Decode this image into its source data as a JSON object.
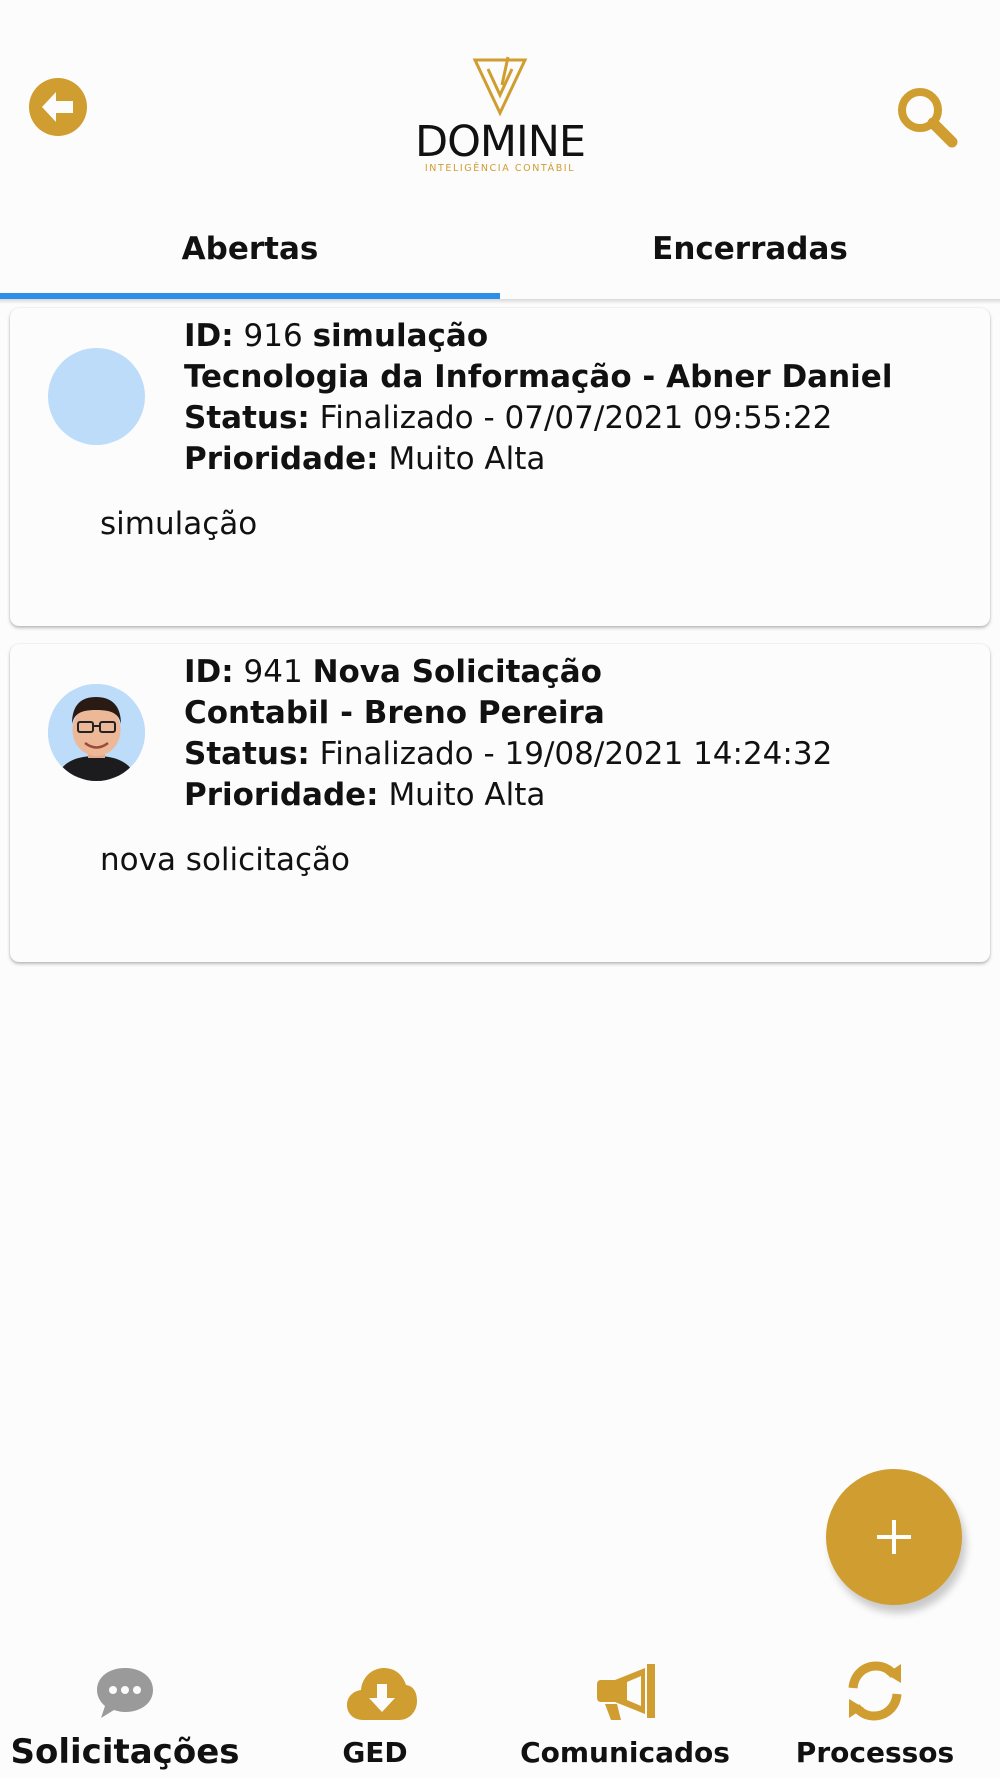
{
  "header": {
    "logo_word": "DOMINE",
    "logo_sub": "INTELIGÊNCIA CONTÁBIL",
    "back_icon": "arrow-left-circle-icon",
    "search_icon": "search-icon"
  },
  "colors": {
    "brand": "#cf9d30",
    "tab_indicator": "#2e8fe6",
    "avatar_bg": "#bcdcfa"
  },
  "tabs": [
    {
      "label": "Abertas",
      "active": true
    },
    {
      "label": "Encerradas",
      "active": false
    }
  ],
  "labels": {
    "id": "ID:",
    "status": "Status:",
    "priority": "Prioridade:"
  },
  "requests": [
    {
      "id": "916",
      "title": "simulação",
      "department_user": "Tecnologia da Informação - Abner Daniel",
      "status": "Finalizado - 07/07/2021 09:55:22",
      "priority": "Muito Alta",
      "description": "simulação",
      "avatar": "blank"
    },
    {
      "id": "941",
      "title": "Nova Solicitação",
      "department_user": "Contabil - Breno Pereira",
      "status": "Finalizado - 19/08/2021 14:24:32",
      "priority": "Muito Alta",
      "description": "nova solicitação",
      "avatar": "photo"
    }
  ],
  "fab": {
    "icon": "plus-icon"
  },
  "bottom_nav": [
    {
      "label": "Solicitações",
      "icon": "chat-bubble-icon",
      "active": true
    },
    {
      "label": "GED",
      "icon": "cloud-download-icon",
      "active": false
    },
    {
      "label": "Comunicados",
      "icon": "megaphone-icon",
      "active": false
    },
    {
      "label": "Processos",
      "icon": "sync-icon",
      "active": false
    }
  ]
}
